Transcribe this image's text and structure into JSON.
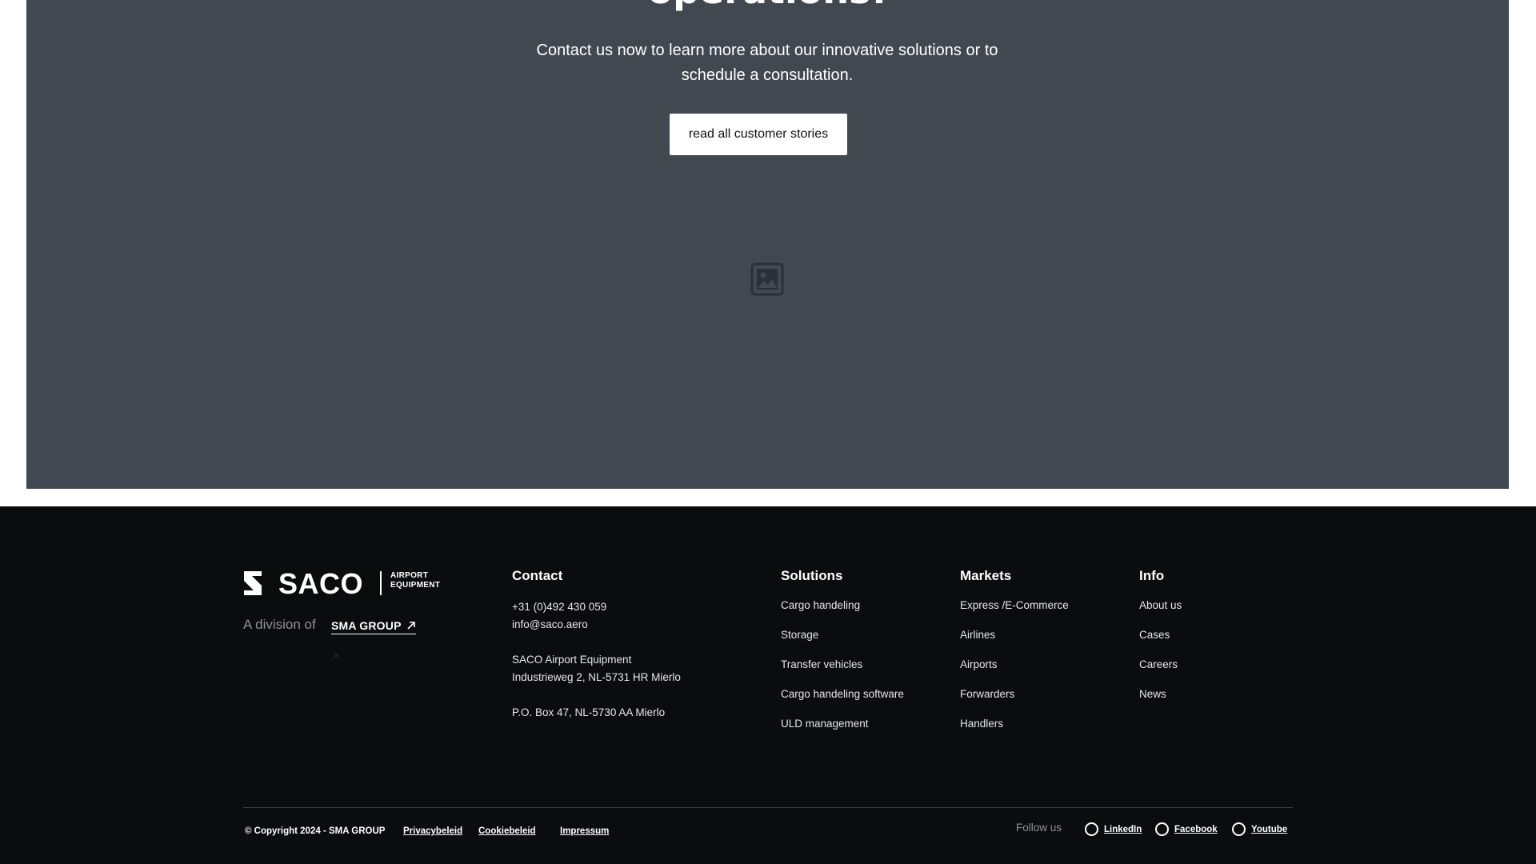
{
  "hero": {
    "title": "operations!",
    "description": "Contact us now to learn more about our innovative solutions or to schedule a consultation.",
    "cta_label": "read all customer stories",
    "image_icon": "image-placeholder-icon"
  },
  "footer": {
    "logo": {
      "name": "SACO",
      "tagline_1": "AIRPORT",
      "tagline_2": "EQUIPMENT"
    },
    "division_text": "A division of",
    "division_link": "SMA GROUP",
    "contact": {
      "title": "Contact",
      "phone": "+31 (0)492 430 059",
      "email": "info@saco.aero",
      "company": "SACO Airport Equipment",
      "address": "Industrieweg 2, NL-5731 HR Mierlo",
      "po_box": "P.O. Box 47, NL-5730 AA Mierlo"
    },
    "solutions": {
      "title": "Solutions",
      "items": [
        "Cargo handeling",
        "Storage",
        "Transfer vehicles",
        "Cargo handeling software",
        "ULD management"
      ]
    },
    "markets": {
      "title": "Markets",
      "items": [
        "Express /E-Commerce",
        "Airlines",
        "Airports",
        "Forwarders",
        "Handlers"
      ]
    },
    "info": {
      "title": "Info",
      "items": [
        "About us",
        "Cases",
        "Careers",
        "News"
      ]
    },
    "bottom": {
      "copyright": "© Copyright 2024 - SMA GROUP",
      "links": [
        "Privacybeleid",
        "Cookiebeleid",
        "Impressum"
      ],
      "follow_label": "Follow us",
      "socials": [
        "LinkedIn",
        "Facebook",
        "Youtube"
      ]
    }
  },
  "colors": {
    "hero_bg": "#424850",
    "footer_bg": "#0b0c0e",
    "text_muted": "#8e9197"
  }
}
